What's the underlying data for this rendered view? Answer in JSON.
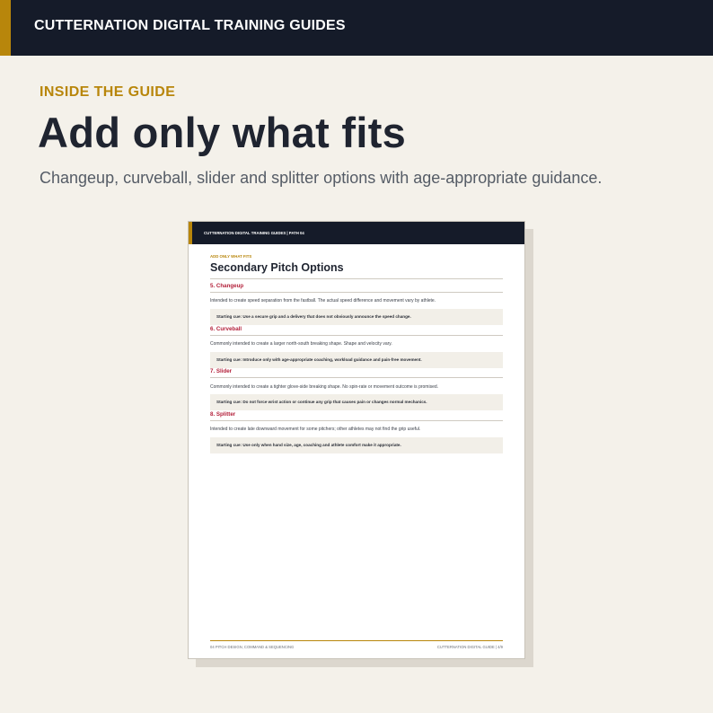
{
  "top_bar": {
    "brand": "CUTTERNATION DIGITAL TRAINING GUIDES"
  },
  "hero": {
    "eyebrow": "INSIDE THE GUIDE",
    "headline": "Add only what fits",
    "subhead": "Changeup, curveball, slider and splitter options with age-appropriate guidance."
  },
  "document": {
    "header": "CUTTERNATION DIGITAL TRAINING GUIDES  |  PATH 04",
    "eyebrow": "ADD ONLY WHAT FITS",
    "title": "Secondary Pitch Options",
    "sections": [
      {
        "title": "5. Changeup",
        "body": "Intended to create speed separation from the fastball. The actual speed difference and movement vary by athlete.",
        "cue": "Starting cue: Use a secure grip and a delivery that does not obviously announce the speed change."
      },
      {
        "title": "6. Curveball",
        "body": "Commonly intended to create a larger north-south breaking shape. Shape and velocity vary.",
        "cue": "Starting cue: Introduce only with age-appropriate coaching, workload guidance and pain-free movement."
      },
      {
        "title": "7. Slider",
        "body": "Commonly intended to create a tighter glove-side breaking shape. No spin-rate or movement outcome is promised.",
        "cue": "Starting cue: Do not force wrist action or continue any grip that causes pain or changes normal mechanics."
      },
      {
        "title": "8. Splitter",
        "body": "Intended to create late downward movement for some pitchers; other athletes may not find the grip useful.",
        "cue": "Starting cue: Use only when hand size, age, coaching and athlete comfort make it appropriate."
      }
    ],
    "footer_left": "04  PITCH DESIGN, COMMAND & SEQUENCING",
    "footer_right": "CUTTERNATION DIGITAL GUIDE  |  4/9"
  },
  "colors": {
    "navy": "#151b29",
    "gold": "#b8860b",
    "background": "#f4f1ea",
    "section_red": "#b3203a"
  }
}
